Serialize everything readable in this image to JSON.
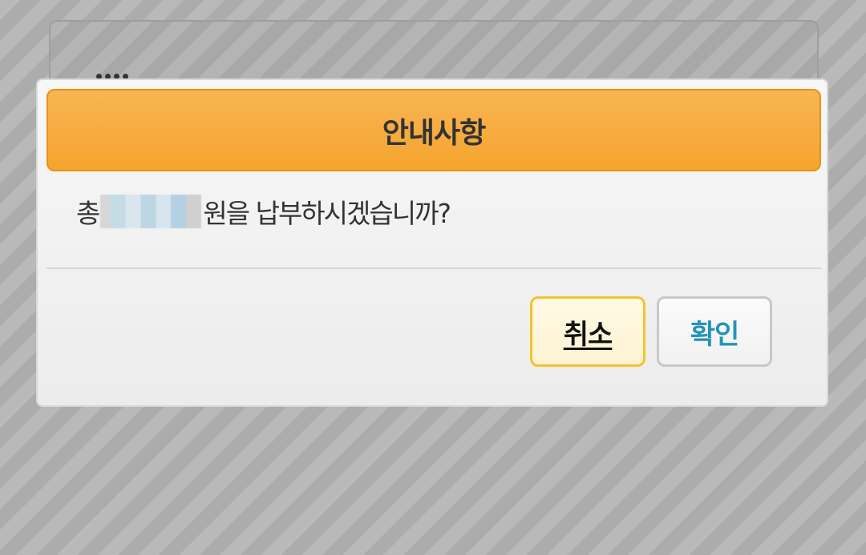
{
  "background": {
    "panel_dots": "····"
  },
  "dialog": {
    "title": "안내사항",
    "message_prefix": "총",
    "message_suffix": "원을 납부하시겠습니까?",
    "buttons": {
      "cancel_label": "취소",
      "confirm_label": "확인"
    }
  },
  "colors": {
    "header_orange": "#f7ad43",
    "cancel_border": "#f2c42e",
    "confirm_text": "#2493b8"
  }
}
